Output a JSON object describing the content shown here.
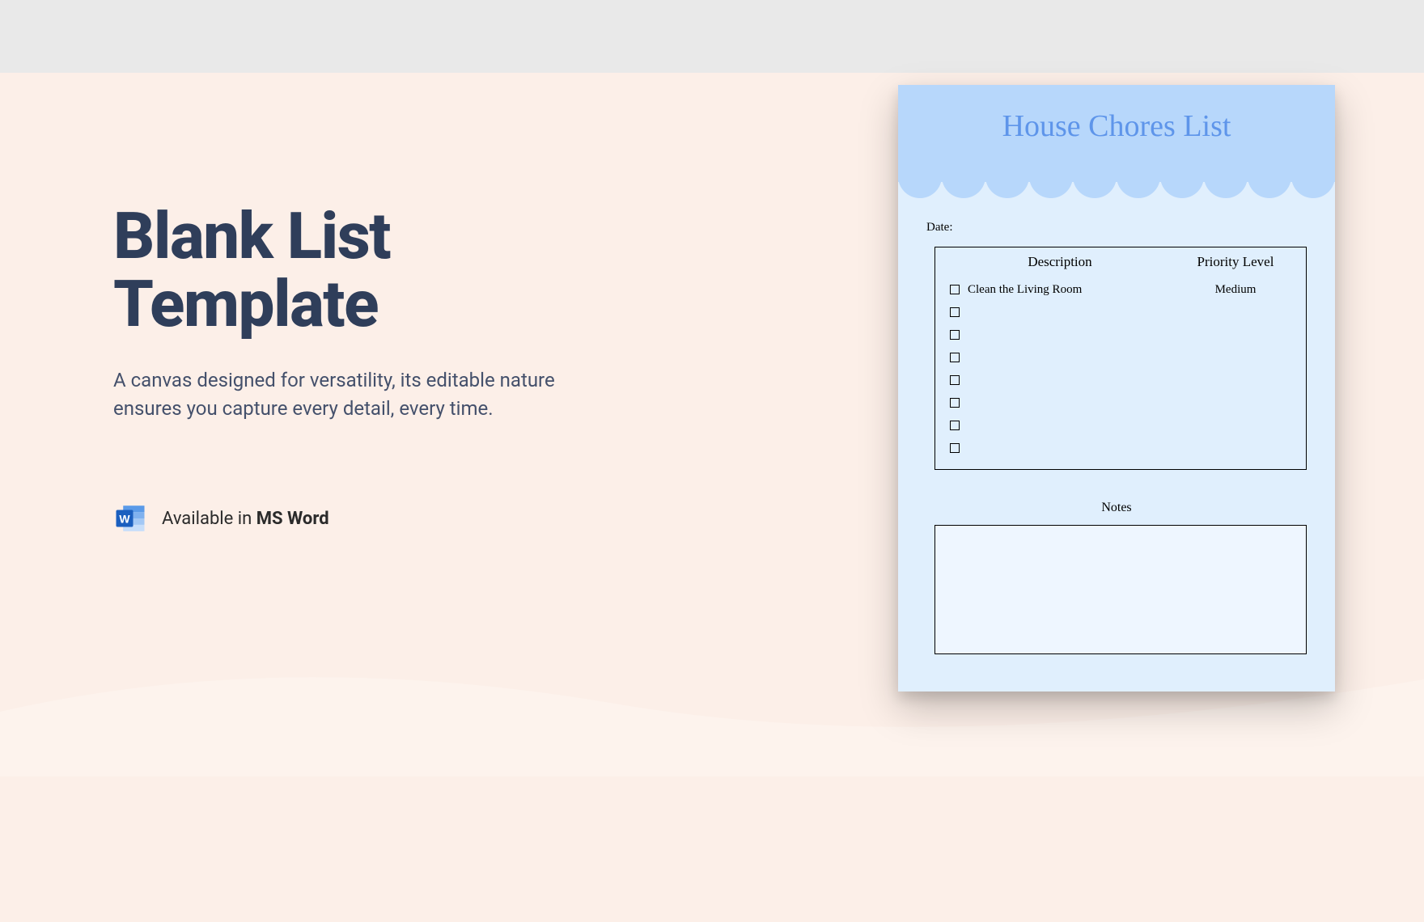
{
  "hero": {
    "title": "Blank List Template",
    "subtitle": "A canvas designed for versatility, its editable nature ensures you capture every detail, every time."
  },
  "availability": {
    "prefix": "Available in ",
    "app": "MS Word"
  },
  "preview": {
    "title": "House Chores List",
    "date_label": "Date:",
    "columns": {
      "description": "Description",
      "priority": "Priority Level"
    },
    "rows": [
      {
        "text": "Clean the Living Room",
        "priority": "Medium"
      },
      {
        "text": "",
        "priority": ""
      },
      {
        "text": "",
        "priority": ""
      },
      {
        "text": "",
        "priority": ""
      },
      {
        "text": "",
        "priority": ""
      },
      {
        "text": "",
        "priority": ""
      },
      {
        "text": "",
        "priority": ""
      },
      {
        "text": "",
        "priority": ""
      }
    ],
    "notes_label": "Notes"
  },
  "colors": {
    "hero_bg": "#fcefe8",
    "preview_bg": "#e0effd",
    "header_blue": "#b7d7fb",
    "title_blue": "#5e95ea",
    "text_navy": "#2f3e5a"
  }
}
